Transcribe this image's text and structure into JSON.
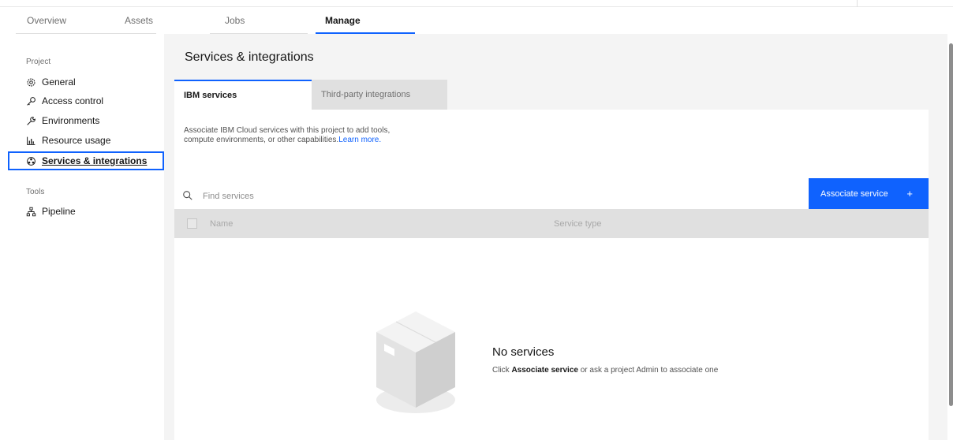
{
  "top_tabs": [
    {
      "label": "Overview"
    },
    {
      "label": "Assets"
    },
    {
      "label": "Jobs"
    },
    {
      "label": "Manage"
    }
  ],
  "sidebar": {
    "project_heading": "Project",
    "items": [
      {
        "label": "General",
        "icon": "gear-icon"
      },
      {
        "label": "Access control",
        "icon": "key-icon"
      },
      {
        "label": "Environments",
        "icon": "wrench-icon"
      },
      {
        "label": "Resource usage",
        "icon": "chart-icon"
      },
      {
        "label": "Services & integrations",
        "icon": "services-icon"
      }
    ],
    "tools_heading": "Tools",
    "tools_items": [
      {
        "label": "Pipeline",
        "icon": "pipeline-icon"
      }
    ]
  },
  "main": {
    "title": "Services & integrations",
    "subtabs": [
      {
        "label": "IBM services"
      },
      {
        "label": "Third-party integrations"
      }
    ],
    "description": "Associate IBM Cloud services with this project to add tools, compute environments, or other capabilities.",
    "learn_more": "Learn more.",
    "search_placeholder": "Find services",
    "associate_button": "Associate service",
    "plus_glyph": "+",
    "table_headers": {
      "name": "Name",
      "service_type": "Service type"
    },
    "empty_title": "No services",
    "empty_pre": "Click ",
    "empty_bold": "Associate service",
    "empty_post": " or ask a project Admin to associate one"
  },
  "colors": {
    "accent": "#0f62fe",
    "panel_bg": "#f4f4f4",
    "header_bg": "#e0e0e0"
  }
}
